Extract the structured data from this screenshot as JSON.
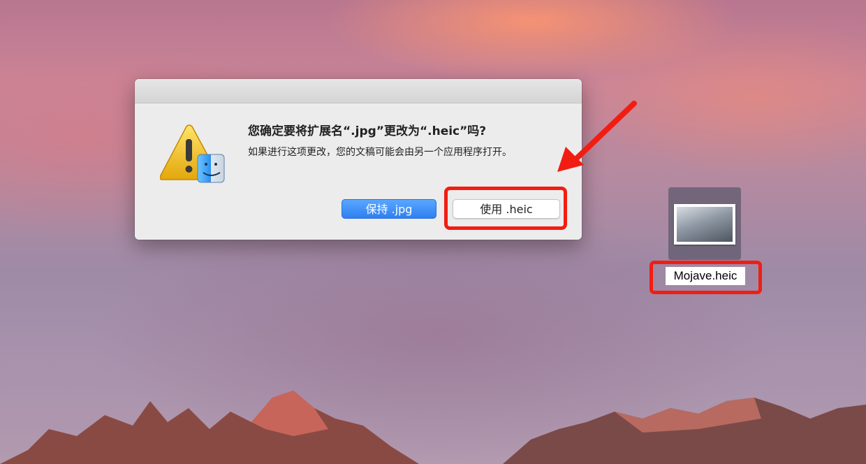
{
  "dialog": {
    "title": "您确定要将扩展名“.jpg”更改为“.heic”吗?",
    "message": "如果进行这项更改，您的文稿可能会由另一个应用程序打开。",
    "keep_button_label": "保持 .jpg",
    "use_button_label": "使用 .heic",
    "icon": "warning-finder-icon"
  },
  "desktop": {
    "file": {
      "name": "Mojave.heic",
      "icon": "image-file-icon"
    }
  },
  "colors": {
    "highlight": "#f21d12",
    "primary_button": "#2f7ff1"
  }
}
